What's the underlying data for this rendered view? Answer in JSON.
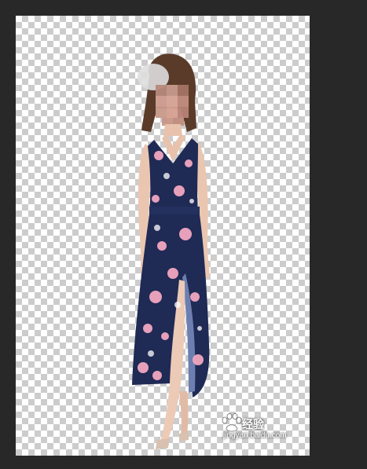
{
  "workspace": {
    "background_color": "#282828"
  },
  "canvas": {
    "transparency": "checkerboard",
    "checker_colors": [
      "#ffffff",
      "#cccccc"
    ]
  },
  "layer_content": {
    "subject": "figure-cutout",
    "dress_color": "#1f2a55",
    "flower_color": "#f2a7c0",
    "face_pixelated": true
  },
  "watermark": {
    "brand": "经验",
    "url": "jingyan.baidu.com",
    "icon": "baidu-paw-icon"
  }
}
